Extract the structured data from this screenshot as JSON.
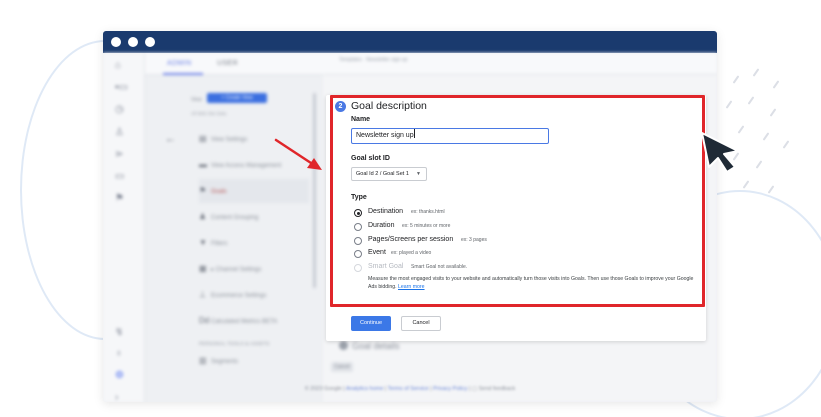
{
  "titlebar": {
    "color": "#1a3a6e"
  },
  "tabs": [
    {
      "label": "ADMIN",
      "active": true
    },
    {
      "label": "USER",
      "active": false
    }
  ],
  "view_panel": {
    "view_label": "View",
    "create_view_label": "+ Create View",
    "view_name": "All Web Site Data",
    "nav_items": [
      {
        "icon": "document-icon",
        "glyph": "▤",
        "label": "View Settings",
        "active": false
      },
      {
        "icon": "people-icon",
        "glyph": "👥",
        "label": "View Access Management",
        "active": false
      },
      {
        "icon": "flag-icon",
        "glyph": "⚑",
        "label": "Goals",
        "active": true
      },
      {
        "icon": "person-icon",
        "glyph": "♟",
        "label": "Content Grouping",
        "active": false
      },
      {
        "icon": "filter-icon",
        "glyph": "▼",
        "label": "Filters",
        "active": false
      },
      {
        "icon": "channel-icon",
        "glyph": "▦",
        "label": "▸ Channel Settings",
        "active": false
      },
      {
        "icon": "cart-icon",
        "glyph": "🛒",
        "label": "Ecommerce Settings",
        "active": false
      },
      {
        "icon": "dd-icon",
        "glyph": "Dd",
        "label": "Calculated Metrics BETA",
        "active": false
      }
    ],
    "section_label": "PERSONAL TOOLS & ASSETS",
    "segments_label": "Segments"
  },
  "background": {
    "top_text": "Templates · Newsletter sign up",
    "goal_details_label": "Goal details",
    "cancel_label": "Cancel"
  },
  "goal_form": {
    "step_number": "2",
    "title": "Goal description",
    "name_label": "Name",
    "name_value": "Newsletter sign up",
    "slot_label": "Goal slot ID",
    "slot_value": "Goal Id 2 / Goal Set 1",
    "type_label": "Type",
    "types": [
      {
        "label": "Destination",
        "example": "ex: thanks.html",
        "checked": true,
        "disabled": false
      },
      {
        "label": "Duration",
        "example": "ex: 5 minutes or more",
        "checked": false,
        "disabled": false
      },
      {
        "label": "Pages/Screens per session",
        "example": "ex: 3 pages",
        "checked": false,
        "disabled": false
      },
      {
        "label": "Event",
        "example": "ex: played a video",
        "checked": false,
        "disabled": false
      },
      {
        "label": "Smart Goal",
        "example": "Smart Goal not available.",
        "checked": false,
        "disabled": true
      }
    ],
    "smart_goal_description": "Measure the most engaged visits to your website and automatically turn those visits into Goals. Then use those Goals to improve your Google Ads bidding.",
    "learn_more_label": "Learn more",
    "continue_label": "Continue",
    "cancel_label": "Cancel"
  },
  "footer": {
    "copyright": "© 2023 Google | ",
    "links": [
      "Analytics home",
      "Terms of Service",
      "Privacy Policy"
    ],
    "feedback": "Send feedback"
  },
  "colors": {
    "highlight": "#e0262a",
    "primary": "#3b78e7",
    "arrow": "#e0262a",
    "cursor": "#1f2a36"
  }
}
